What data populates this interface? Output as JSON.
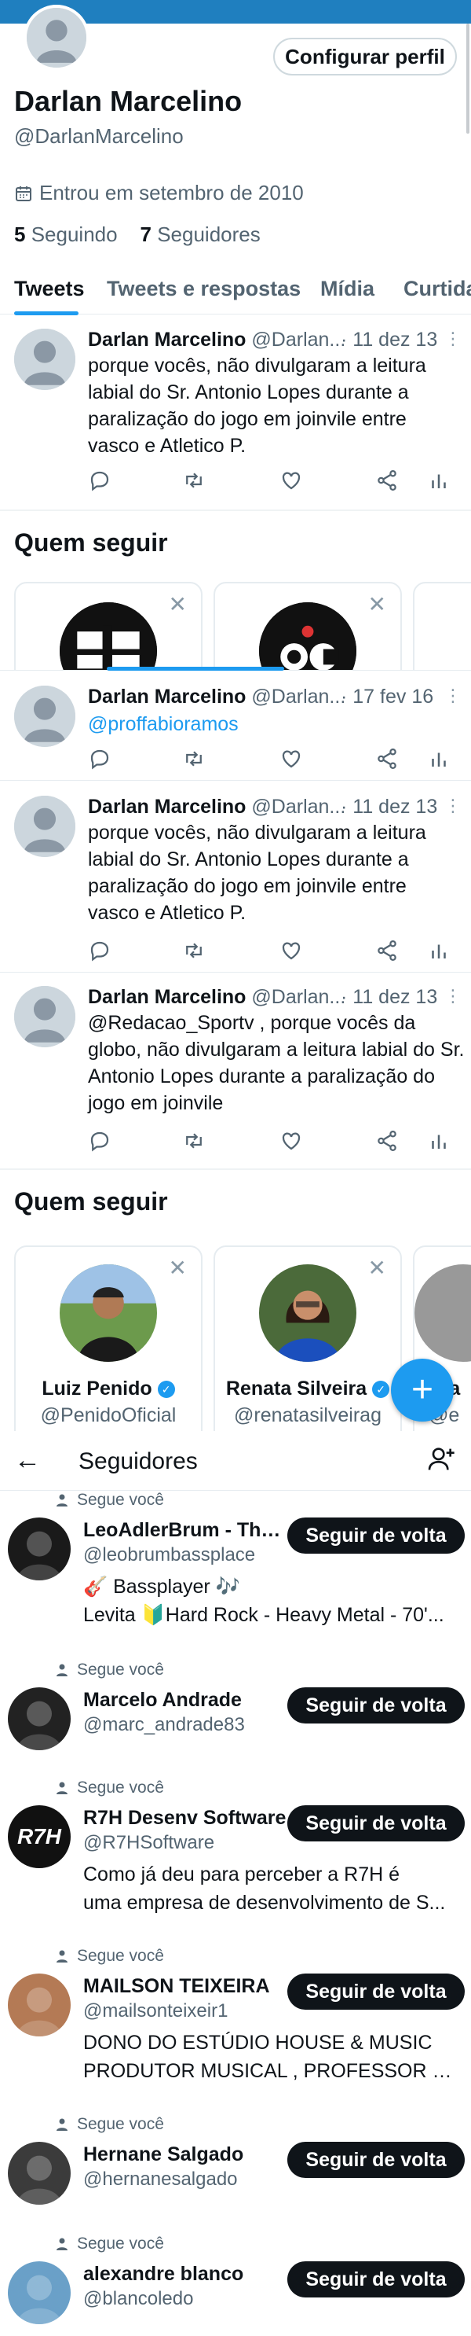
{
  "colors": {
    "accent": "#1d9bf0",
    "banner": "#1f7fbf",
    "text": "#0f1419",
    "muted": "#536471",
    "button_dark": "#0f1419"
  },
  "profile": {
    "name": "Darlan Marcelino",
    "handle": "@DarlanMarcelino",
    "edit_label": "Configurar perfil",
    "joined": "Entrou em setembro de 2010",
    "following_count": "5",
    "following_label": "Seguindo",
    "followers_count": "7",
    "followers_label": "Seguidores"
  },
  "tabs": [
    {
      "label": "Tweets",
      "active": true
    },
    {
      "label": "Tweets e respostas"
    },
    {
      "label": "Mídia"
    },
    {
      "label": "Curtida"
    }
  ],
  "tweets": [
    {
      "name": "Darlan Marcelino",
      "handle": "@Darlan...",
      "date": "· 11 dez 13",
      "text": "porque vocês, não divulgaram a leitura labial do Sr. Antonio Lopes durante a paralização do jogo em joinvile entre vasco e Atletico P."
    },
    {
      "name": "Darlan Marcelino",
      "handle": "@Darlan...",
      "date": "· 17 fev 16",
      "text": "@proffabioramos"
    },
    {
      "name": "Darlan Marcelino",
      "handle": "@Darlan...",
      "date": "· 11 dez 13",
      "text": "porque vocês, não divulgaram a leitura labial do Sr. Antonio Lopes durante a paralização do jogo em joinvile entre vasco e Atletico P."
    },
    {
      "name": "Darlan Marcelino",
      "handle": "@Darlan...",
      "date": "· 11 dez 13",
      "text": "@Redacao_Sportv  , porque vocês da globo, não divulgaram a leitura labial do Sr. Antonio Lopes durante a paralização do jogo em joinvile"
    }
  ],
  "who_to_follow": {
    "title": "Quem seguir",
    "cards": [
      {
        "name": "Luiz Penido",
        "handle": "@PenidoOficial",
        "verified": true
      },
      {
        "name": "Renata Silveira",
        "handle": "@renatasilveirag",
        "verified": true
      },
      {
        "name": "Era",
        "handle": "@e"
      }
    ]
  },
  "followers_page": {
    "title": "Seguidores",
    "follows_you": "Segue você",
    "follow_back": "Seguir de volta",
    "items": [
      {
        "name": "LeoAdlerBrum - The ...",
        "handle": "@leobrumbassplace",
        "bio1": "🎸 Bassplayer 🎶",
        "bio2": "Levita 🔰Hard Rock - Heavy Metal - 70'..."
      },
      {
        "name": "Marcelo Andrade",
        "handle": "@marc_andrade83"
      },
      {
        "name": "R7H Desenv Software",
        "handle": "@R7HSoftware",
        "bio1": "Como já deu para perceber a R7H é",
        "bio2": "uma empresa de desenvolvimento de S...",
        "avatar_text": "R7H"
      },
      {
        "name": "MAILSON TEIXEIRA",
        "handle": "@mailsonteixeir1",
        "bio1": "DONO DO ESTÚDIO HOUSE & MUSIC",
        "bio2": "PRODUTOR MUSICAL , PROFESSOR DE ..."
      },
      {
        "name": "Hernane Salgado",
        "handle": "@hernanesalgado"
      },
      {
        "name": "alexandre blanco",
        "handle": "@blancoledo"
      }
    ]
  },
  "icons": [
    "calendar-icon",
    "reply-icon",
    "retweet-icon",
    "like-icon",
    "share-icon",
    "analytics-icon",
    "close-icon",
    "plus-icon",
    "back-arrow-icon",
    "add-user-icon",
    "person-icon"
  ]
}
